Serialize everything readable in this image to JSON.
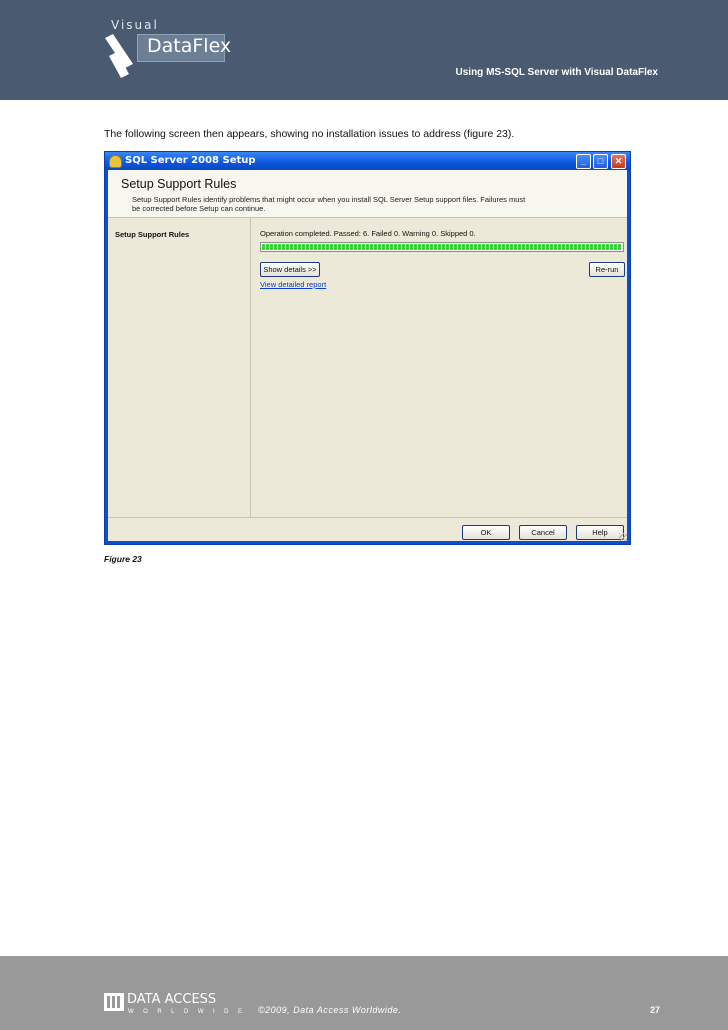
{
  "header": {
    "logo_visual": "Visual",
    "logo_name": "DataFlex",
    "title": "Using MS-SQL Server with Visual DataFlex"
  },
  "intro_text": "The following screen then appears, showing no installation issues to address (figure 23).",
  "dialog": {
    "title": "SQL Server 2008 Setup",
    "window_buttons": {
      "minimize": "_",
      "maximize": "□",
      "close": "✕"
    },
    "banner_title": "Setup Support Rules",
    "banner_description": "Setup Support Rules identify problems that might occur when you install SQL Server Setup support files. Failures must be corrected before Setup can continue.",
    "sidebar_items": [
      "Setup Support Rules"
    ],
    "status": "Operation completed.  Passed: 6.   Failed 0.   Warning 0.   Skipped 0.",
    "progress": 1.0,
    "show_details_label": "Show details >>",
    "rerun_label": "Re-run",
    "report_link": "View detailed report",
    "ok_label": "OK",
    "cancel_label": "Cancel",
    "help_label": "Help",
    "colors": {
      "titlebar": "#0b57e0",
      "progress": "#3bd13b",
      "client": "#ece9d8"
    }
  },
  "caption": "Figure 23",
  "footer": {
    "logo_main": "DATA ACCESS",
    "logo_sub": "WORLDWIDE",
    "copyright": "©2009, Data Access Worldwide.",
    "page_number": "27"
  }
}
